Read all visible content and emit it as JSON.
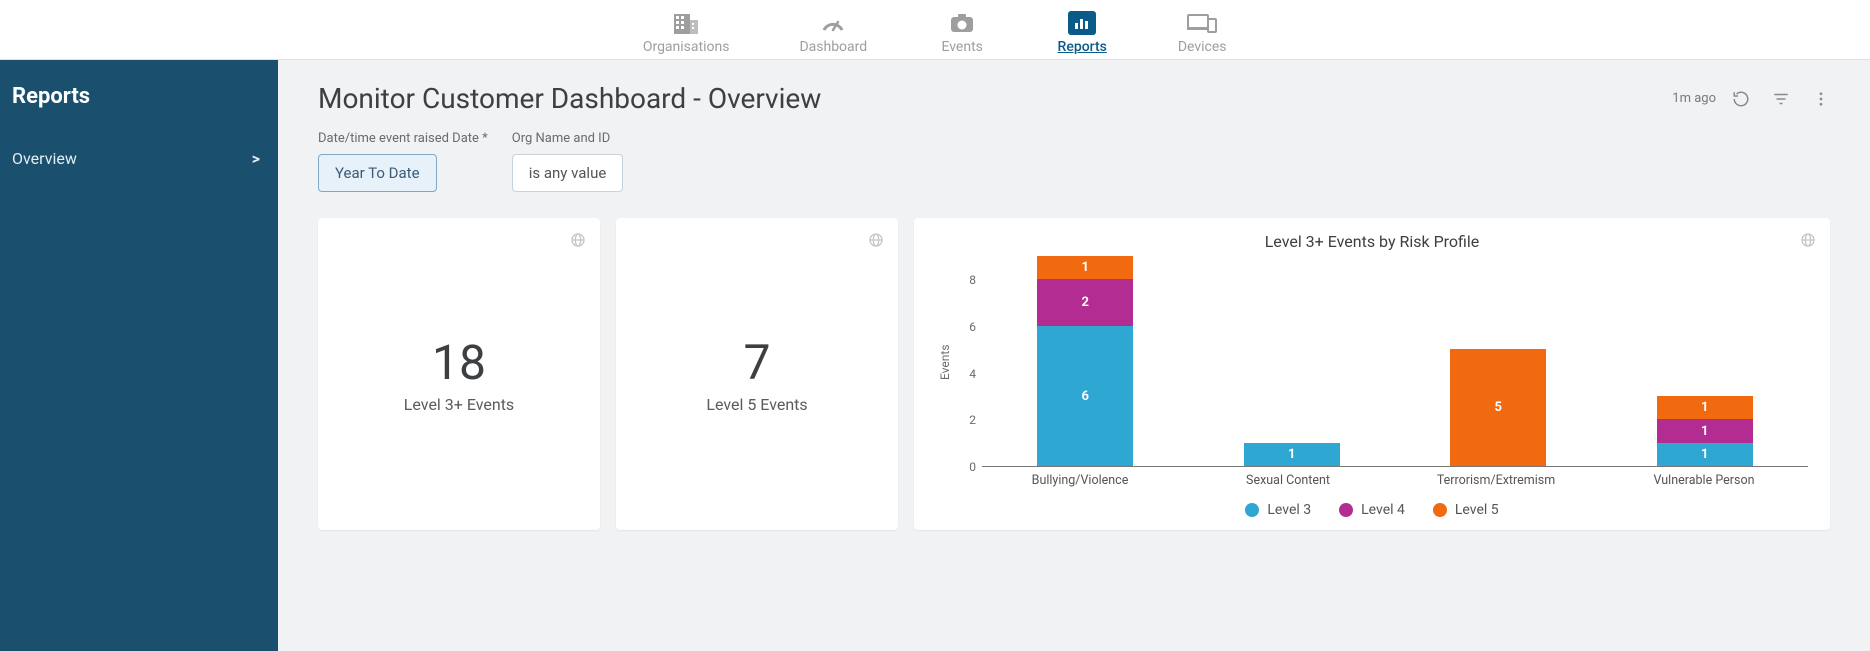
{
  "nav": {
    "items": [
      {
        "label": "Organisations"
      },
      {
        "label": "Dashboard"
      },
      {
        "label": "Events"
      },
      {
        "label": "Reports"
      },
      {
        "label": "Devices"
      }
    ]
  },
  "sidebar": {
    "title": "Reports",
    "items": [
      {
        "label": "Overview",
        "chevron": ">"
      }
    ]
  },
  "page": {
    "title": "Monitor Customer Dashboard - Overview",
    "updated": "1m ago"
  },
  "filters": {
    "date": {
      "label": "Date/time event raised Date *",
      "value": "Year To Date"
    },
    "org": {
      "label": "Org Name and ID",
      "value": "is any value"
    }
  },
  "metrics": [
    {
      "value": "18",
      "label": "Level 3+ Events"
    },
    {
      "value": "7",
      "label": "Level 5 Events"
    }
  ],
  "chart_data": {
    "type": "bar",
    "title": "Level 3+ Events by Risk Profile",
    "ylabel": "Events",
    "ylim": [
      0,
      9
    ],
    "yticks": [
      0,
      2,
      4,
      6,
      8
    ],
    "categories": [
      "Bullying/Violence",
      "Sexual Content",
      "Terrorism/Extremism",
      "Vulnerable Person"
    ],
    "series": [
      {
        "name": "Level 3",
        "values": [
          6,
          1,
          0,
          1
        ]
      },
      {
        "name": "Level 4",
        "values": [
          2,
          0,
          0,
          1
        ]
      },
      {
        "name": "Level 5",
        "values": [
          1,
          0,
          5,
          1
        ]
      }
    ]
  }
}
